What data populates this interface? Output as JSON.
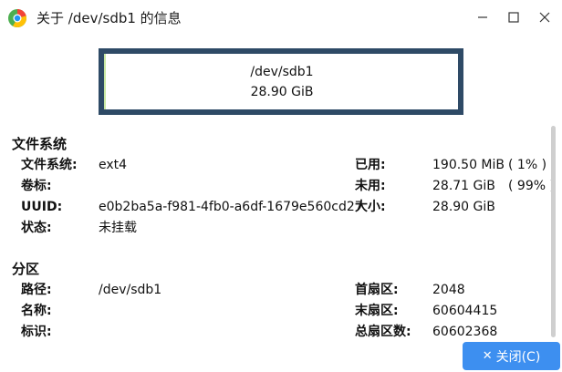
{
  "window": {
    "title": "关于 /dev/sdb1 的信息"
  },
  "partition_bar": {
    "device": "/dev/sdb1",
    "size": "28.90 GiB"
  },
  "filesystem_section": {
    "heading": "文件系统",
    "filesystem_label": "文件系统:",
    "filesystem_value": "ext4",
    "volume_label": "卷标:",
    "volume_value": "",
    "uuid_label": "UUID:",
    "uuid_value": "e0b2ba5a-f981-4fb0-a6df-1679e560cd27",
    "status_label": "状态:",
    "status_value": "未挂载",
    "used_label": "已用:",
    "used_value": "190.50 MiB",
    "used_percent": "( 1% )",
    "unused_label": "未用:",
    "unused_value": "28.71 GiB",
    "unused_percent": "( 99% )",
    "size_label": "大小:",
    "size_value": "28.90 GiB"
  },
  "partition_section": {
    "heading": "分区",
    "path_label": "路径:",
    "path_value": "/dev/sdb1",
    "name_label": "名称:",
    "name_value": "",
    "flags_label": "标识:",
    "flags_value": "",
    "first_sector_label": "首扇区:",
    "first_sector_value": "2048",
    "last_sector_label": "末扇区:",
    "last_sector_value": "60604415",
    "total_sectors_label": "总扇区数:",
    "total_sectors_value": "60602368"
  },
  "buttons": {
    "close_label": "关闭(C)",
    "close_icon": "close-x-icon"
  },
  "colors": {
    "partbar_border": "#2e4a66",
    "used_marker": "#c9e8a3",
    "accent_button": "#3d8ff0"
  }
}
